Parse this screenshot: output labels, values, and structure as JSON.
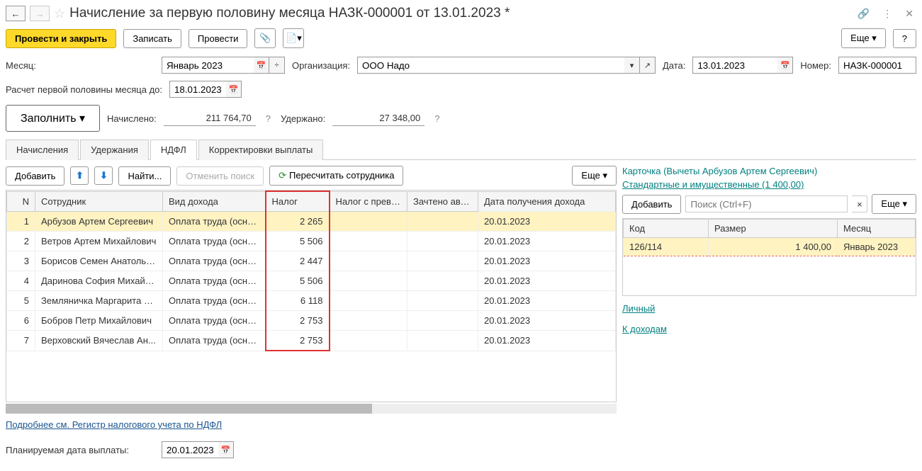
{
  "title": "Начисление за первую половину месяца НАЗК-000001 от 13.01.2023 *",
  "toolbar": {
    "post_close": "Провести и закрыть",
    "write": "Записать",
    "post": "Провести",
    "more": "Еще",
    "help": "?"
  },
  "fields": {
    "month_label": "Месяц:",
    "month_value": "Январь 2023",
    "org_label": "Организация:",
    "org_value": "ООО Надо",
    "date_label": "Дата:",
    "date_value": "13.01.2023",
    "number_label": "Номер:",
    "number_value": "НАЗК-000001",
    "calc_until_label": "Расчет первой половины месяца до:",
    "calc_until_value": "18.01.2023",
    "fill": "Заполнить",
    "accrued_label": "Начислено:",
    "accrued_value": "211 764,70",
    "withheld_label": "Удержано:",
    "withheld_value": "27 348,00",
    "planned_label": "Планируемая дата выплаты:",
    "planned_value": "20.01.2023"
  },
  "tabs": {
    "accruals": "Начисления",
    "withholdings": "Удержания",
    "ndfl": "НДФЛ",
    "corrections": "Корректировки выплаты"
  },
  "grid_toolbar": {
    "add": "Добавить",
    "find": "Найти...",
    "cancel_search": "Отменить поиск",
    "recalc": "Пересчитать сотрудника",
    "more": "Еще"
  },
  "columns": {
    "n": "N",
    "employee": "Сотрудник",
    "income_type": "Вид дохода",
    "tax": "Налог",
    "tax_excess": "Налог с превы...",
    "credited": "Зачтено ава...",
    "income_date": "Дата получения дохода"
  },
  "rows": [
    {
      "n": "1",
      "emp": "Арбузов Артем Сергеевич",
      "type": "Оплата труда (осно...",
      "tax": "2 265",
      "excess": "",
      "credit": "",
      "date": "20.01.2023"
    },
    {
      "n": "2",
      "emp": "Ветров Артем Михайлович",
      "type": "Оплата труда (осно...",
      "tax": "5 506",
      "excess": "",
      "credit": "",
      "date": "20.01.2023"
    },
    {
      "n": "3",
      "emp": "Борисов Семен Анатолье...",
      "type": "Оплата труда (осно...",
      "tax": "2 447",
      "excess": "",
      "credit": "",
      "date": "20.01.2023"
    },
    {
      "n": "4",
      "emp": "Даринова София Михайл...",
      "type": "Оплата труда (осно...",
      "tax": "5 506",
      "excess": "",
      "credit": "",
      "date": "20.01.2023"
    },
    {
      "n": "5",
      "emp": "Земляничка Маргарита С...",
      "type": "Оплата труда (осно...",
      "tax": "6 118",
      "excess": "",
      "credit": "",
      "date": "20.01.2023"
    },
    {
      "n": "6",
      "emp": "Бобров Петр Михайлович",
      "type": "Оплата труда (осно...",
      "tax": "2 753",
      "excess": "",
      "credit": "",
      "date": "20.01.2023"
    },
    {
      "n": "7",
      "emp": "Верховский Вячеслав Ан...",
      "type": "Оплата труда (осно...",
      "tax": "2 753",
      "excess": "",
      "credit": "",
      "date": "20.01.2023"
    }
  ],
  "footer_link": "Подробнее см. Регистр налогового учета по НДФЛ",
  "right": {
    "card": "Карточка (Вычеты Арбузов Артем Сергеевич)",
    "standard": "Стандартные и имущественные (1 400,00)",
    "add": "Добавить",
    "search_placeholder": "Поиск (Ctrl+F)",
    "more": "Еще",
    "col_code": "Код",
    "col_size": "Размер",
    "col_month": "Месяц",
    "row_code": "126/114",
    "row_size": "1 400,00",
    "row_month": "Январь 2023",
    "personal": "Личный",
    "to_income": "К доходам"
  }
}
